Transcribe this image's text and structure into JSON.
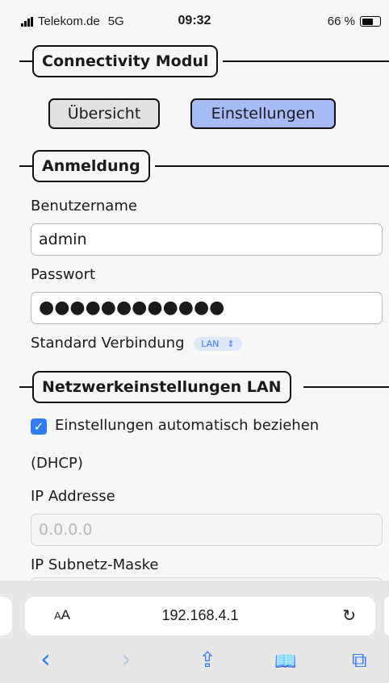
{
  "status_bar": {
    "carrier": "Telekom.de",
    "network": "5G",
    "time": "09:32",
    "battery": "66 %",
    "battery_level": 0.66
  },
  "sections": {
    "connectivity_title": "Connectivity Modul",
    "login_title": "Anmeldung",
    "lan_title": "Netzwerkeinstellungen LAN"
  },
  "nav_buttons": {
    "overview": "Übersicht",
    "settings": "Einstellungen"
  },
  "login": {
    "username_label": "Benutzername",
    "username_value": "admin",
    "password_label": "Passwort",
    "password_mask": "●●●●●●●●●●●●",
    "default_connection_label": "Standard Verbindung",
    "default_connection_value": "LAN",
    "select_arrow": "⇕"
  },
  "lan": {
    "dhcp_label": "Einstellungen automatisch beziehen",
    "dhcp_label_cont": "(DHCP)",
    "dhcp_checked": true,
    "check_glyph": "✓",
    "ip_label": "IP Addresse",
    "ip_placeholder": "0.0.0.0",
    "subnet_label": "IP Subnetz-Maske"
  },
  "browser": {
    "aa_small": "A",
    "aa_large": "A",
    "url": "192.168.4.1",
    "reload_glyph": "↻",
    "toolbar": {
      "back": "‹",
      "forward": "›",
      "share": "⇪",
      "bookmarks": "📖",
      "tabs": "⧉"
    }
  },
  "colors": {
    "accent": "#2f7cf6",
    "settings_button": "#a7bbf7",
    "overview_button": "#e2e2e2"
  }
}
